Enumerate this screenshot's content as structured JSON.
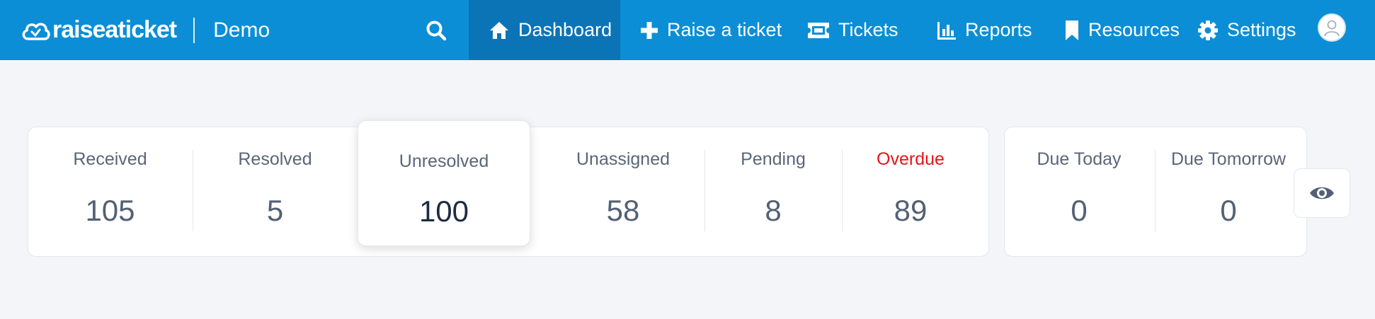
{
  "app": {
    "brand": "raiseaticket",
    "workspace": "Demo"
  },
  "nav": {
    "items": [
      {
        "label": "Dashboard",
        "icon": "home-icon"
      },
      {
        "label": "Raise a ticket",
        "icon": "plus-icon"
      },
      {
        "label": "Tickets",
        "icon": "ticket-icon"
      },
      {
        "label": "Reports",
        "icon": "bar-chart-icon"
      },
      {
        "label": "Resources",
        "icon": "bookmark-icon"
      },
      {
        "label": "Settings",
        "icon": "gear-icon"
      }
    ],
    "active": "Dashboard"
  },
  "stats": {
    "received": {
      "label": "Received",
      "value": "105"
    },
    "resolved": {
      "label": "Resolved",
      "value": "5"
    },
    "unresolved": {
      "label": "Unresolved",
      "value": "100"
    },
    "unassigned": {
      "label": "Unassigned",
      "value": "58"
    },
    "pending": {
      "label": "Pending",
      "value": "8"
    },
    "overdue": {
      "label": "Overdue",
      "value": "89"
    }
  },
  "due": {
    "today": {
      "label": "Due Today",
      "value": "0"
    },
    "tomorrow": {
      "label": "Due Tomorrow",
      "value": "0"
    }
  },
  "colors": {
    "topbar": "#0b8ed6",
    "active_nav": "#0a74b7",
    "overdue": "#e8141c"
  }
}
